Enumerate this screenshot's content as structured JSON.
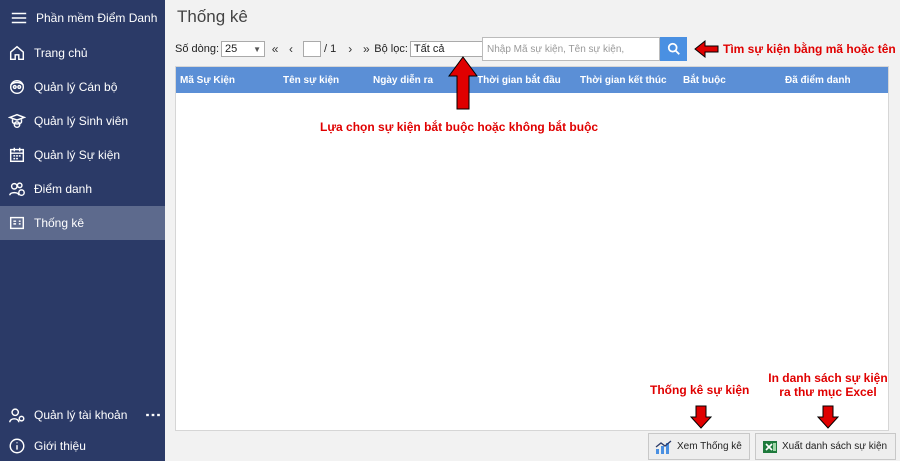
{
  "sidebar": {
    "app_title": "Phần mềm Điểm Danh",
    "items": [
      {
        "label": "Trang chủ"
      },
      {
        "label": "Quản lý Cán bộ"
      },
      {
        "label": "Quản lý Sinh viên"
      },
      {
        "label": "Quản lý Sự kiện"
      },
      {
        "label": "Điểm danh"
      },
      {
        "label": "Thống kê"
      }
    ],
    "bottom": [
      {
        "label": "Quản lý tài khoản"
      },
      {
        "label": "Giới thiệu"
      }
    ]
  },
  "main": {
    "title": "Thống kê",
    "toolbar": {
      "rows_label": "Số dòng:",
      "rows_value": "25",
      "page_sep": "/ 1",
      "filter_label": "Bộ lọc:",
      "filter_value": "Tất cả",
      "search_placeholder": "Nhập Mã sự kiện, Tên sự kiện,"
    },
    "table": {
      "columns": [
        "Mã Sự Kiện",
        "Tên sự kiện",
        "Ngày diễn ra",
        "Thời gian bắt đầu",
        "Thời gian kết thúc",
        "Bắt buộc",
        "Đã điểm danh"
      ]
    },
    "buttons": {
      "view_stats": "Xem Thống kê",
      "export_excel": "Xuất danh sách sự kiện"
    }
  },
  "annotations": {
    "search_note": "Tìm sự kiện bằng mã hoặc tên",
    "filter_note": "Lựa chọn sự kiện bắt buộc hoặc không bắt buộc",
    "stats_note": "Thống kê sự kiện",
    "excel_note_1": "In danh sách sự kiện",
    "excel_note_2": "ra thư mục Excel"
  },
  "colors": {
    "sidebar": "#2b3a67",
    "sidebar_active": "#5d6a8d",
    "table_header": "#5b8fd6",
    "search_button": "#4a90e2",
    "annotation": "#e00000"
  }
}
